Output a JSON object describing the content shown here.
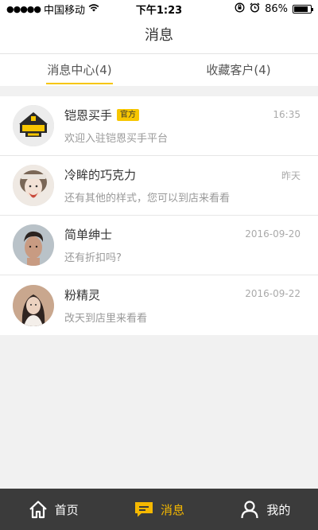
{
  "status_bar": {
    "signal": "●●●●●",
    "carrier": "中国移动",
    "wifi_icon": "wifi-icon",
    "time": "下午1:23",
    "battery": "86%",
    "battery_level": 0.86
  },
  "nav": {
    "title": "消息"
  },
  "tabs": [
    {
      "label": "消息中心(4)",
      "active": true
    },
    {
      "label": "收藏客户(4)",
      "active": false
    }
  ],
  "messages": [
    {
      "name": "铠恩买手",
      "badge": "官方",
      "text": "欢迎入驻铠恩买手平台",
      "time": "16:35",
      "avatar": "brand-logo"
    },
    {
      "name": "冷眸的巧克力",
      "text": "还有其他的样式，您可以到店来看看",
      "time": "昨天",
      "avatar": "user-avatar"
    },
    {
      "name": "简单绅士",
      "text": "还有折扣吗?",
      "time": "2016-09-20",
      "avatar": "user-avatar"
    },
    {
      "name": "粉精灵",
      "text": "改天到店里来看看",
      "time": "2016-09-22",
      "avatar": "user-avatar"
    }
  ],
  "bottom_nav": [
    {
      "label": "首页",
      "icon": "home-icon",
      "active": false
    },
    {
      "label": "消息",
      "icon": "message-icon",
      "active": true
    },
    {
      "label": "我的",
      "icon": "user-icon",
      "active": false
    }
  ],
  "colors": {
    "accent": "#f7c600",
    "tab_bar": "#3b3b3b",
    "active_nav": "#f5b800"
  }
}
